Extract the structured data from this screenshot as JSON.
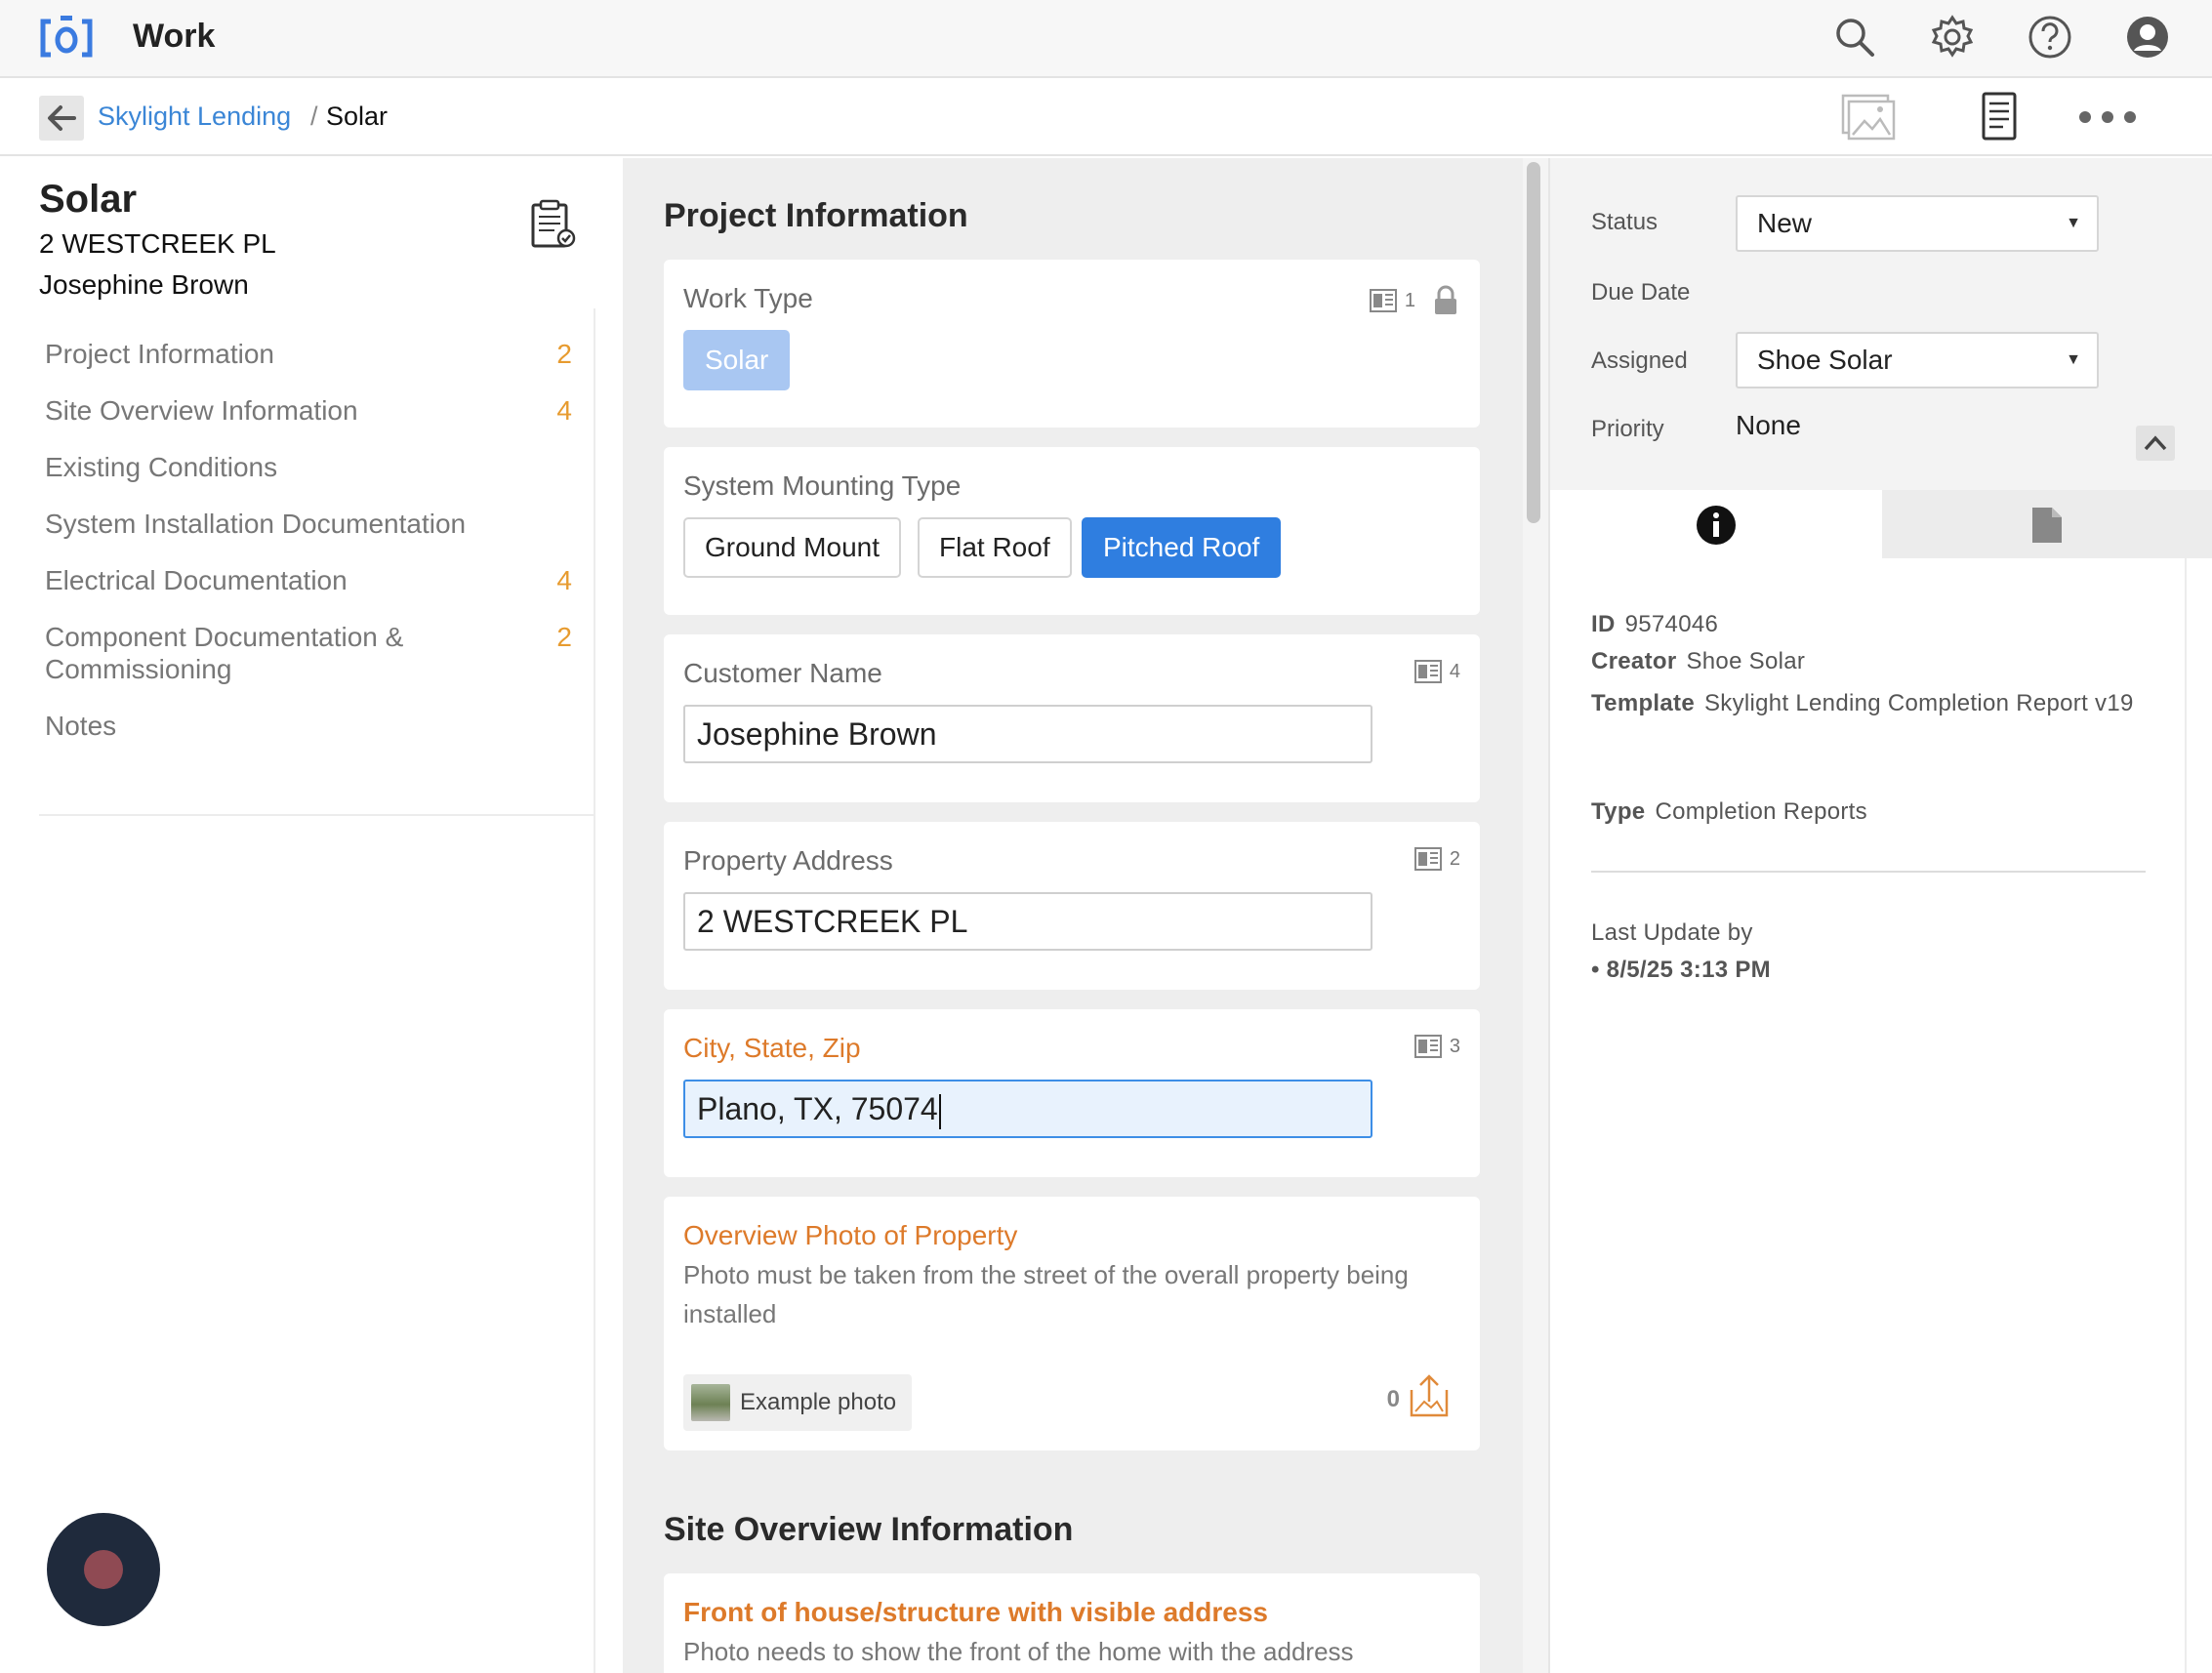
{
  "app": {
    "title": "Work",
    "accent_color": "#3b86d6"
  },
  "topbar": {
    "icons": [
      "search-icon",
      "gear-icon",
      "help-icon",
      "account-icon"
    ]
  },
  "breadcrumb": {
    "parent": "Skylight Lending",
    "separator": "/",
    "current": "Solar",
    "icons": [
      "gallery-icon",
      "report-icon",
      "more-icon"
    ]
  },
  "job": {
    "title": "Solar",
    "address": "2 WESTCREEK PL",
    "customer": "Josephine Brown"
  },
  "nav": [
    {
      "label": "Project Information",
      "count": "2"
    },
    {
      "label": "Site Overview Information",
      "count": "4"
    },
    {
      "label": "Existing Conditions",
      "count": ""
    },
    {
      "label": "System Installation Documentation",
      "count": ""
    },
    {
      "label": "Electrical Documentation",
      "count": "4"
    },
    {
      "label": "Component Documentation & Commissioning",
      "count": "2"
    },
    {
      "label": "Notes",
      "count": ""
    }
  ],
  "form": {
    "section1": "Project Information",
    "work_type": {
      "label": "Work Type",
      "badge": "1",
      "value": "Solar"
    },
    "mounting": {
      "label": "System Mounting Type",
      "options": [
        "Ground Mount",
        "Flat Roof",
        "Pitched Roof"
      ],
      "selected": "Pitched Roof"
    },
    "customer_name": {
      "label": "Customer Name",
      "badge": "4",
      "value": "Josephine Brown"
    },
    "property_address": {
      "label": "Property Address",
      "badge": "2",
      "value": "2 WESTCREEK PL"
    },
    "city_state_zip": {
      "label": "City, State, Zip",
      "badge": "3",
      "value": "Plano, TX, 75074"
    },
    "overview_photo": {
      "label": "Overview Photo of Property",
      "description": "Photo must be taken from the street of the overall property being installed",
      "example_label": "Example photo",
      "count": "0"
    },
    "section2": "Site Overview Information",
    "front_photo": {
      "label": "Front of house/structure with visible address",
      "description": "Photo needs to show the front of the home with the address"
    }
  },
  "details": {
    "status": {
      "label": "Status",
      "value": "New"
    },
    "due_date": {
      "label": "Due Date"
    },
    "assigned": {
      "label": "Assigned",
      "value": "Shoe Solar"
    },
    "priority": {
      "label": "Priority",
      "value": "None"
    },
    "tabs": [
      "info-icon",
      "document-icon"
    ],
    "id": {
      "label": "ID",
      "value": "9574046"
    },
    "creator": {
      "label": "Creator",
      "value": "Shoe Solar"
    },
    "template": {
      "label": "Template",
      "value": "Skylight Lending Completion Report v19"
    },
    "type": {
      "label": "Type",
      "value": "Completion Reports"
    },
    "last_update": {
      "label": "Last Update by",
      "value": "• 8/5/25 3:13 PM"
    }
  }
}
